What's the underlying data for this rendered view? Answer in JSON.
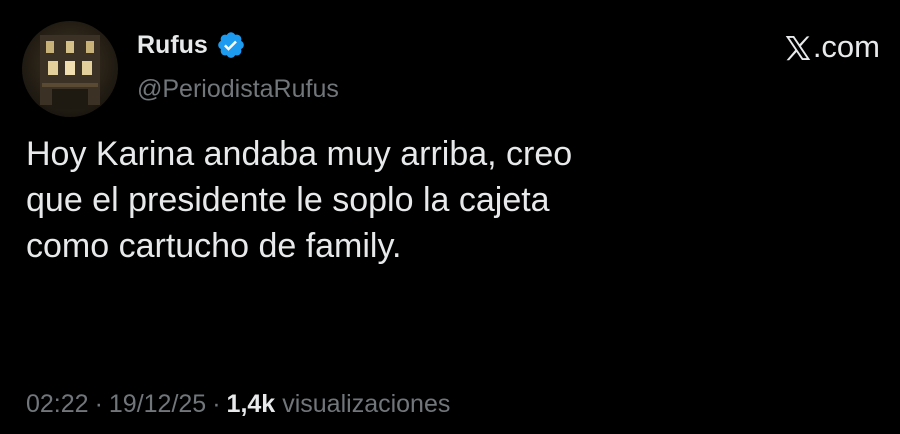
{
  "author": {
    "name": "Rufus",
    "handle": "@PeriodistaRufus",
    "verified": true
  },
  "brand": {
    "icon": "x-logo-icon",
    "suffix": ".com"
  },
  "tweet": {
    "lines": [
      "Hoy Karina andaba muy arriba, creo",
      "que el presidente le soplo la cajeta",
      "como cartucho de family."
    ]
  },
  "meta": {
    "time": "02:22",
    "separator": "·",
    "date": "19/12/25",
    "views_count": "1,4k",
    "views_label": "visualizaciones"
  },
  "colors": {
    "background": "#000000",
    "text": "#e7e9ea",
    "muted": "#71767b",
    "verified_blue": "#1d9bf0"
  }
}
